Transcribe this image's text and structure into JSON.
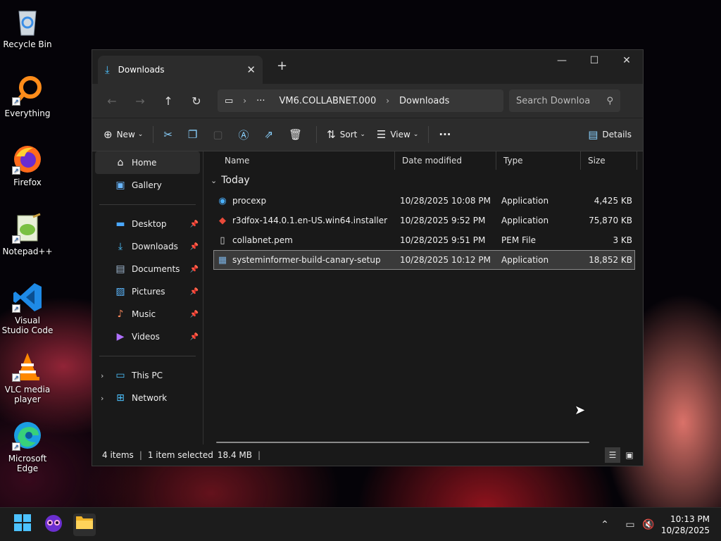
{
  "desktop": {
    "icons": [
      {
        "label": "Recycle Bin",
        "icon": "recycle-bin-icon"
      },
      {
        "label": "Everything",
        "icon": "everything-search-icon"
      },
      {
        "label": "Firefox",
        "icon": "firefox-icon"
      },
      {
        "label": "Notepad++",
        "icon": "notepadpp-icon"
      },
      {
        "label": "Visual Studio Code",
        "icon": "vscode-icon"
      },
      {
        "label": "VLC media player",
        "icon": "vlc-icon"
      },
      {
        "label": "Microsoft Edge",
        "icon": "edge-icon"
      }
    ]
  },
  "window": {
    "tab_title": "Downloads",
    "new_tab": "+",
    "address": {
      "computer": "VM6.COLLABNET.000",
      "folder": "Downloads",
      "more": "···"
    },
    "search_placeholder": "Search Downloa",
    "toolbar": {
      "new": "New",
      "sort": "Sort",
      "view": "View",
      "more": "···",
      "details": "Details"
    },
    "sidebar": {
      "home": "Home",
      "gallery": "Gallery",
      "desktop": "Desktop",
      "downloads": "Downloads",
      "documents": "Documents",
      "pictures": "Pictures",
      "music": "Music",
      "videos": "Videos",
      "this_pc": "This PC",
      "network": "Network"
    },
    "columns": {
      "name": "Name",
      "date": "Date modified",
      "type": "Type",
      "size": "Size"
    },
    "group": "Today",
    "files": [
      {
        "name": "procexp",
        "date": "10/28/2025 10:08 PM",
        "type": "Application",
        "size": "4,425 KB"
      },
      {
        "name": "r3dfox-144.0.1.en-US.win64.installer",
        "date": "10/28/2025 9:52 PM",
        "type": "Application",
        "size": "75,870 KB"
      },
      {
        "name": "collabnet.pem",
        "date": "10/28/2025 9:51 PM",
        "type": "PEM File",
        "size": "3 KB"
      },
      {
        "name": "systeminformer-build-canary-setup",
        "date": "10/28/2025 10:12 PM",
        "type": "Application",
        "size": "18,852 KB"
      }
    ],
    "status": {
      "items": "4 items",
      "selected": "1 item selected",
      "size": "18.4 MB"
    }
  },
  "taskbar": {
    "time": "10:13 PM",
    "date": "10/28/2025"
  }
}
